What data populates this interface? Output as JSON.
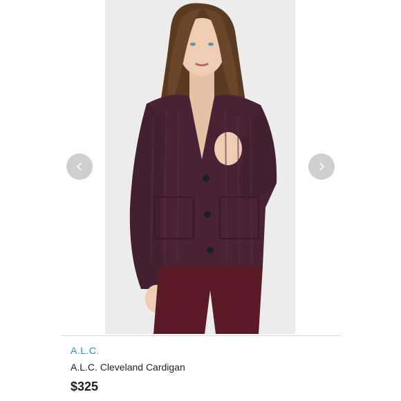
{
  "product": {
    "brand": "A.L.C.",
    "name": "A.L.C. Cleveland Cardigan",
    "price": "$325",
    "image_alt": "Model wearing a plum knit cardigan and burgundy corduroy pants"
  },
  "carousel": {
    "prev_icon": "chevron-left-icon",
    "next_icon": "chevron-right-icon"
  },
  "colors": {
    "brand_link": "#2a8fc7",
    "cardigan": "#4a2236",
    "pants": "#5a1a26",
    "photo_background": "#ececec"
  }
}
